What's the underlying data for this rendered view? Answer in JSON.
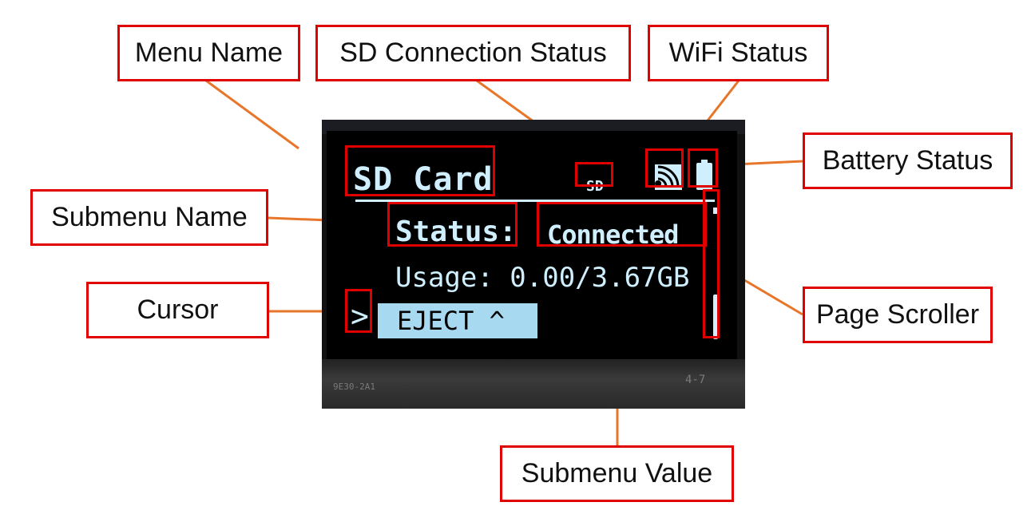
{
  "callouts": {
    "menu_name": "Menu Name",
    "sd_status": "SD Connection Status",
    "wifi_status": "WiFi Status",
    "battery_status": "Battery Status",
    "submenu_name": "Submenu Name",
    "cursor": "Cursor",
    "page_scroller": "Page Scroller",
    "submenu_value": "Submenu Value"
  },
  "screen": {
    "menu_name": "SD Card",
    "sd_badge": "SD",
    "submenu_name": "Status:",
    "submenu_value": "Connected",
    "usage_line": "Usage: 0.00/3.67GB",
    "cursor_glyph": ">",
    "eject_label": "EJECT ^"
  },
  "board_text": {
    "left": "9E30-2A1",
    "right": "4-7"
  },
  "colors": {
    "callout_border": "#e00000",
    "leader_line": "#e8762a",
    "screen_text": "#cfefff",
    "highlight_bar": "#a7d9f0"
  },
  "icons": {
    "wifi": "wifi-signal-icon",
    "battery": "battery-icon"
  }
}
